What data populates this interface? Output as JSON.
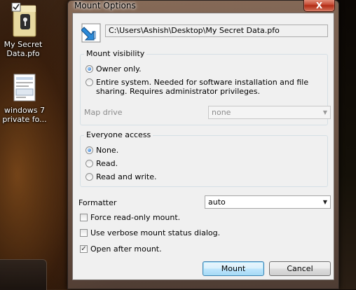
{
  "desktop": {
    "icons": [
      {
        "name": "folder-lock-icon",
        "label": "My Secret Data.pfo"
      },
      {
        "name": "document-thumbnail-icon",
        "label": "windows 7 private fo..."
      }
    ]
  },
  "window": {
    "title": "Mount Options",
    "close_label": "X"
  },
  "path": {
    "value": "C:\\Users\\Ashish\\Desktop\\My Secret Data.pfo"
  },
  "mount_visibility": {
    "label": "Mount visibility",
    "options": [
      {
        "label": "Owner only.",
        "selected": true
      },
      {
        "label": "Entire system. Needed for software installation and file sharing. Requires administrator privileges.",
        "selected": false
      }
    ],
    "map_drive_label": "Map drive",
    "map_drive_value": "none"
  },
  "everyone_access": {
    "label": "Everyone access",
    "options": [
      {
        "label": "None.",
        "selected": true
      },
      {
        "label": "Read.",
        "selected": false
      },
      {
        "label": "Read and write.",
        "selected": false
      }
    ]
  },
  "formatter": {
    "label": "Formatter",
    "value": "auto"
  },
  "checkboxes": [
    {
      "label": "Force read-only mount.",
      "checked": false
    },
    {
      "label": "Use verbose mount status dialog.",
      "checked": false
    },
    {
      "label": "Open after mount.",
      "checked": true
    }
  ],
  "buttons": {
    "mount": "Mount",
    "cancel": "Cancel"
  }
}
